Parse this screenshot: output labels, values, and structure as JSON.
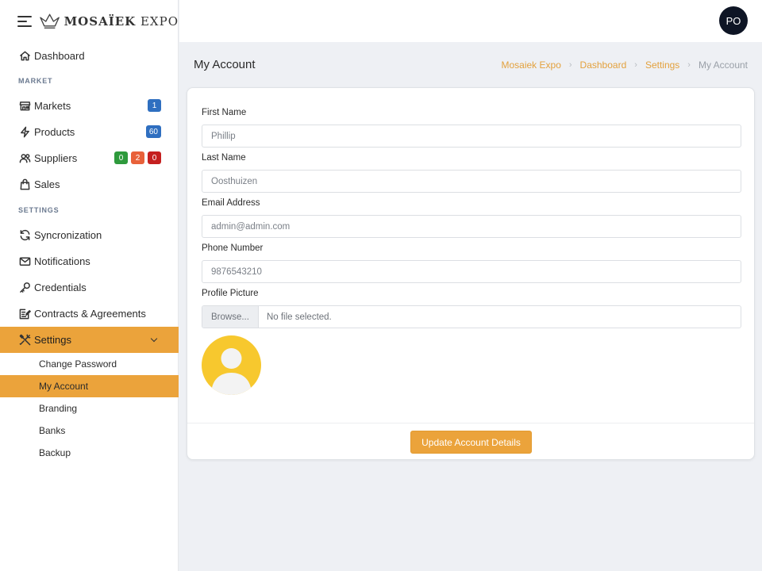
{
  "brand": {
    "name_bold": "MOSAÏEK",
    "name_rest": " EXPO"
  },
  "sidebar": {
    "dashboard": {
      "label": "Dashboard",
      "icon": "home-icon"
    },
    "section_market": "MARKET",
    "markets": {
      "label": "Markets",
      "icon": "store-icon",
      "badge": "1",
      "badge_color": "#2f6fc0"
    },
    "products": {
      "label": "Products",
      "icon": "bolt-icon",
      "badge": "60",
      "badge_color": "#2f6fc0"
    },
    "suppliers": {
      "label": "Suppliers",
      "icon": "users-icon",
      "badges": [
        {
          "value": "0",
          "color": "#2e9a3c"
        },
        {
          "value": "2",
          "color": "#e8613a"
        },
        {
          "value": "0",
          "color": "#c52020"
        }
      ]
    },
    "sales": {
      "label": "Sales",
      "icon": "shopping-bag-icon"
    },
    "section_settings": "SETTINGS",
    "syncronization": {
      "label": "Syncronization",
      "icon": "refresh-icon"
    },
    "notifications": {
      "label": "Notifications",
      "icon": "envelope-icon"
    },
    "credentials": {
      "label": "Credentials",
      "icon": "key-icon"
    },
    "contracts": {
      "label": "Contracts & Agreements",
      "icon": "edit-document-icon"
    },
    "settings": {
      "label": "Settings",
      "icon": "tools-icon"
    },
    "sub_items": [
      "Change Password",
      "My Account",
      "Branding",
      "Banks",
      "Backup"
    ],
    "active_sub": "My Account",
    "active_color": "#eba33b"
  },
  "topbar": {
    "user_initials": "PO"
  },
  "page": {
    "title": "My Account",
    "breadcrumb": [
      "Mosaiek Expo",
      "Dashboard",
      "Settings",
      "My Account"
    ]
  },
  "form": {
    "first_name": {
      "label": "First Name",
      "value": "Phillip"
    },
    "last_name": {
      "label": "Last Name",
      "value": "Oosthuizen"
    },
    "email": {
      "label": "Email Address",
      "value": "admin@admin.com"
    },
    "phone": {
      "label": "Phone Number",
      "value": "9876543210"
    },
    "profile_picture": {
      "label": "Profile Picture",
      "browse_label": "Browse...",
      "file_status": "No file selected."
    },
    "submit_label": "Update Account Details"
  }
}
